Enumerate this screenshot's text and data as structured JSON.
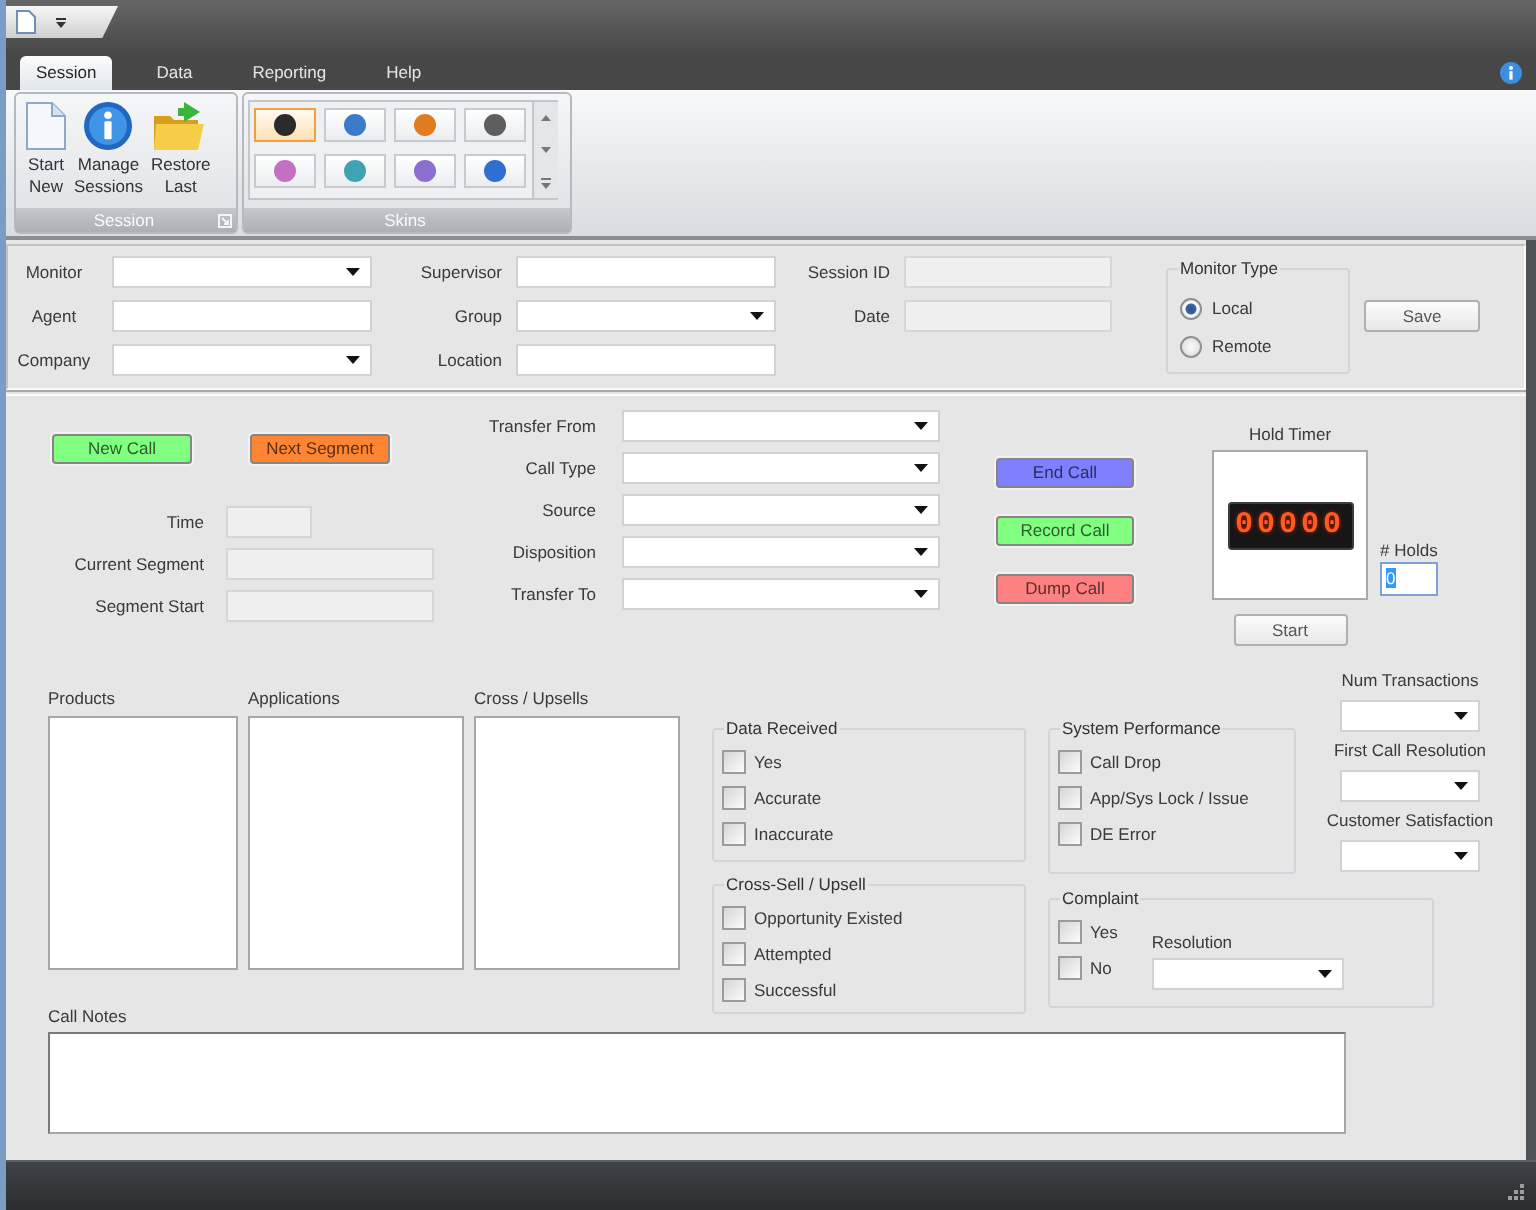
{
  "ribbon": {
    "tabs": [
      {
        "label": "Session",
        "selected": true
      },
      {
        "label": "Data",
        "selected": false
      },
      {
        "label": "Reporting",
        "selected": false
      },
      {
        "label": "Help",
        "selected": false
      }
    ],
    "groups": [
      {
        "kind": "buttons",
        "label": "Session",
        "launcher": true,
        "buttons": [
          {
            "label": "Start New"
          },
          {
            "label": "Manage Sessions"
          },
          {
            "label": "Restore Last"
          }
        ]
      },
      {
        "kind": "gallery",
        "label": "Skins",
        "skins": [
          {
            "color": "#2b2b2b",
            "selected": true
          },
          {
            "color": "#3a7cc9",
            "selected": false
          },
          {
            "color": "#e07b22",
            "selected": false
          },
          {
            "color": "#5e5e5e",
            "selected": false
          },
          {
            "color": "#c46ec4",
            "selected": false
          },
          {
            "color": "#3fa3b3",
            "selected": false
          },
          {
            "color": "#8a6fd0",
            "selected": false
          },
          {
            "color": "#2f6fd2",
            "selected": false
          }
        ]
      }
    ]
  },
  "session": {
    "fields": [
      {
        "label": "Monitor",
        "kind": "select"
      },
      {
        "label": "Supervisor",
        "kind": "text"
      },
      {
        "label": "Session ID",
        "kind": "readonly"
      },
      {
        "label": "Agent",
        "kind": "text"
      },
      {
        "label": "Group",
        "kind": "select"
      },
      {
        "label": "Date",
        "kind": "readonly"
      },
      {
        "label": "Company",
        "kind": "select"
      },
      {
        "label": "Location",
        "kind": "text"
      }
    ],
    "monitor_type": {
      "title": "Monitor Type",
      "options": [
        {
          "label": "Local",
          "selected": true
        },
        {
          "label": "Remote",
          "selected": false
        }
      ]
    },
    "save_button": "Save"
  },
  "call": {
    "buttons": [
      {
        "label": "New Call",
        "color": "#80ff80"
      },
      {
        "label": "Next Segment",
        "color": "#ff8533"
      }
    ],
    "timing_fields": [
      {
        "label": "Time"
      },
      {
        "label": "Current Segment"
      },
      {
        "label": "Segment Start"
      }
    ],
    "transfer_fields": [
      {
        "label": "Transfer From"
      },
      {
        "label": "Call Type"
      },
      {
        "label": "Source"
      },
      {
        "label": "Disposition"
      },
      {
        "label": "Transfer To"
      }
    ],
    "actions": [
      {
        "label": "End Call",
        "color": "#7f7fff"
      },
      {
        "label": "Record Call",
        "color": "#80ff80"
      },
      {
        "label": "Dump Call",
        "color": "#ff8080"
      }
    ],
    "hold_timer": {
      "title": "Hold Timer",
      "display": "00000",
      "button": "Start"
    },
    "holds": {
      "label": "# Holds",
      "value": "0",
      "highlighted": true
    }
  },
  "details": {
    "lists": [
      {
        "label": "Products"
      },
      {
        "label": "Applications"
      },
      {
        "label": "Cross / Upsells"
      }
    ],
    "groups": [
      {
        "title": "Data Received",
        "options": [
          {
            "label": "Yes",
            "checked": false
          },
          {
            "label": "Accurate",
            "checked": false
          },
          {
            "label": "Inaccurate",
            "checked": false
          }
        ]
      },
      {
        "title": "Cross-Sell / Upsell",
        "options": [
          {
            "label": "Opportunity Existed",
            "checked": false
          },
          {
            "label": "Attempted",
            "checked": false
          },
          {
            "label": "Successful",
            "checked": false
          }
        ]
      },
      {
        "title": "System Performance",
        "options": [
          {
            "label": "Call Drop",
            "checked": false
          },
          {
            "label": "App/Sys Lock / Issue",
            "checked": false
          },
          {
            "label": "DE Error",
            "checked": false
          }
        ]
      },
      {
        "title": "Complaint",
        "options": [
          {
            "label": "Yes",
            "checked": false
          },
          {
            "label": "No",
            "checked": false
          }
        ],
        "resolution": {
          "label": "Resolution"
        }
      }
    ],
    "ratings": [
      {
        "label": "Num Transactions"
      },
      {
        "label": "First Call Resolution"
      },
      {
        "label": "Customer Satisfaction"
      }
    ],
    "call_notes": {
      "label": "Call Notes"
    }
  }
}
